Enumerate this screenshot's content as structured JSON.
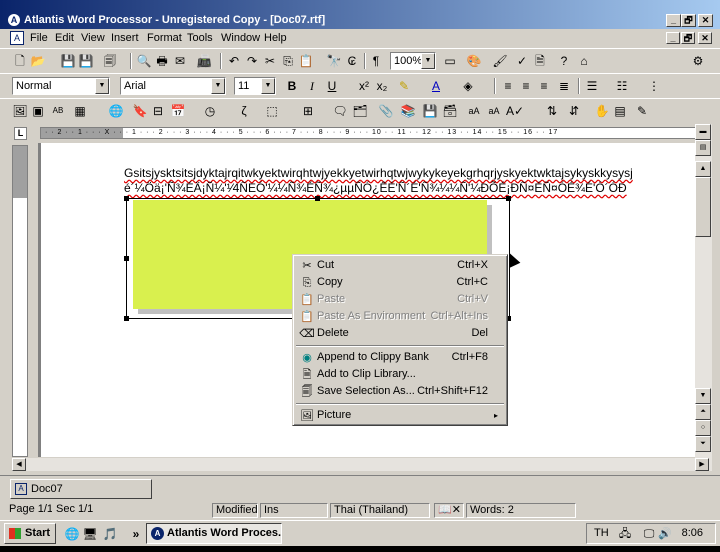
{
  "window": {
    "title": "Atlantis Word Processor - Unregistered Copy - [Doc07.rtf]",
    "controls": {
      "minimize": "_",
      "maximize": "🗗",
      "close": "✕"
    }
  },
  "menubar": {
    "items": [
      "File",
      "Edit",
      "View",
      "Insert",
      "Format",
      "Tools",
      "Window",
      "Help"
    ]
  },
  "format_bar": {
    "style": "Normal",
    "font": "Arial",
    "size": "11",
    "zoom": "100%"
  },
  "ruler": {
    "numbers": "· · 2 · · 1 · · · X · · · 1 · · · 2 · · · 3 · · · 4 · · · 5 · · · 6 · · · 7 · · · 8 · · · 9 · · · 10 · · 11 · · 12 · · 13 · · 14 · · 15 · · 16 · · 17"
  },
  "document": {
    "line1": "Gsitsjysktsitsjdyktajrqitwkyektwirqhtwjyekkyetwirhqtwjwykykeyekgrhqrjyskyektwktajsykyskkysysj",
    "line2": "é´¼Öä¡'Ñ¾ÉÄ¡Ñ¼'¹⁄4ÑEÓ'¼¼Ñ¾ÉÑ¾¿µµÑÓ¿ÊÉ'Ñ´É'Ñ¾¼¼Ñ'¼ÐÕÉ¡ÐÑ¤ÉÑ¤ÓÉ¾É'Ó´ÓÐ",
    "shape_color": "#d9f04e"
  },
  "context_menu": {
    "items": [
      {
        "label": "Cut",
        "shortcut": "Ctrl+X",
        "icon": "scissors-icon",
        "disabled": false
      },
      {
        "label": "Copy",
        "shortcut": "Ctrl+C",
        "icon": "copy-icon",
        "disabled": false
      },
      {
        "label": "Paste",
        "shortcut": "Ctrl+V",
        "icon": "paste-icon",
        "disabled": true
      },
      {
        "label": "Paste As Environment",
        "shortcut": "Ctrl+Alt+Ins",
        "icon": "paste-icon",
        "disabled": true
      },
      {
        "label": "Delete",
        "shortcut": "Del",
        "icon": "eraser-icon",
        "disabled": false
      },
      {
        "label": "Append to Clippy Bank",
        "shortcut": "Ctrl+F8",
        "icon": "clippy-icon",
        "disabled": false
      },
      {
        "label": "Add to Clip Library...",
        "shortcut": "",
        "icon": "clip-library-icon",
        "disabled": false
      },
      {
        "label": "Save Selection As...",
        "shortcut": "Ctrl+Shift+F12",
        "icon": "save-selection-icon",
        "disabled": false
      },
      {
        "label": "Picture",
        "shortcut": "",
        "icon": "picture-icon",
        "disabled": false,
        "submenu": "▸"
      }
    ]
  },
  "doc_tab": {
    "label": "Doc07"
  },
  "statusbar": {
    "page": "Page 1/1",
    "section": "Sec 1/1",
    "modified": "Modified",
    "ins": "Ins",
    "language": "Thai (Thailand)",
    "words": "Words: 2"
  },
  "taskbar": {
    "start": "Start",
    "quick_more": "»",
    "task": "Atlantis Word Proces...",
    "lang": "TH",
    "clock": "8:06"
  }
}
